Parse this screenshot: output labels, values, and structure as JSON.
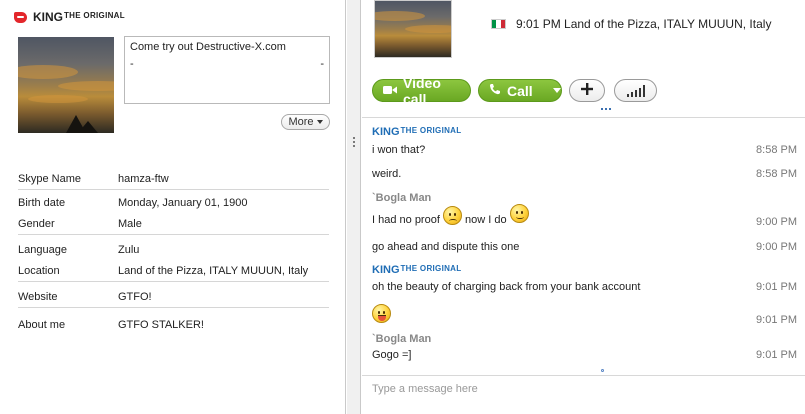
{
  "profile": {
    "name_main": "KING",
    "name_sup": "THE ORIGINAL",
    "mood_line1": "Come try out Destructive-X.com",
    "mood_line2_left": "-",
    "mood_line2_right": "-",
    "more_label": "More",
    "fields": [
      {
        "key": "Skype Name",
        "value": "hamza-ftw"
      },
      {
        "key": "Birth date",
        "value": "Monday, January 01, 1900"
      },
      {
        "key": "Gender",
        "value": "Male"
      },
      {
        "key": "Language",
        "value": "Zulu"
      },
      {
        "key": "Location",
        "value": "Land of the Pizza, ITALY MUUUN, Italy"
      },
      {
        "key": "Website",
        "value": "GTFO!"
      },
      {
        "key": "About me",
        "value": "GTFO STALKER!"
      }
    ]
  },
  "header": {
    "local_time_location": "9:01 PM Land of the Pizza, ITALY MUUUN, Italy",
    "video_call_label": "Video call",
    "call_label": "Call"
  },
  "chat": {
    "messages": [
      {
        "sender": "KING",
        "sender_sup": "THE ORIGINAL",
        "text": "i won that?",
        "time": "8:58 PM"
      },
      {
        "text": "weird.",
        "time": "8:58 PM"
      },
      {
        "sender": "`Bogla Man",
        "text_a": "I had no proof",
        "text_b": "now I do",
        "time": "9:00 PM"
      },
      {
        "text": "go ahead and dispute this one",
        "time": "9:00 PM"
      },
      {
        "sender": "KING",
        "sender_sup": "THE ORIGINAL",
        "text": "oh the beauty of charging back from your bank account",
        "time": "9:01 PM"
      },
      {
        "text": "",
        "time": "9:01 PM"
      },
      {
        "sender": "`Bogla Man",
        "text": "Gogo =]",
        "time": "9:01 PM"
      }
    ],
    "input_placeholder": "Type a message here"
  },
  "colors": {
    "accent_green": "#7ab82f",
    "sender_blue": "#1f6db5",
    "status_red": "#e3262b"
  },
  "icons": [
    "status-away-icon",
    "video-camera-icon",
    "phone-icon",
    "plus-icon",
    "signal-bars-icon",
    "italy-flag-icon",
    "sad-emoticon",
    "smile-emoticon",
    "tongue-emoticon"
  ]
}
